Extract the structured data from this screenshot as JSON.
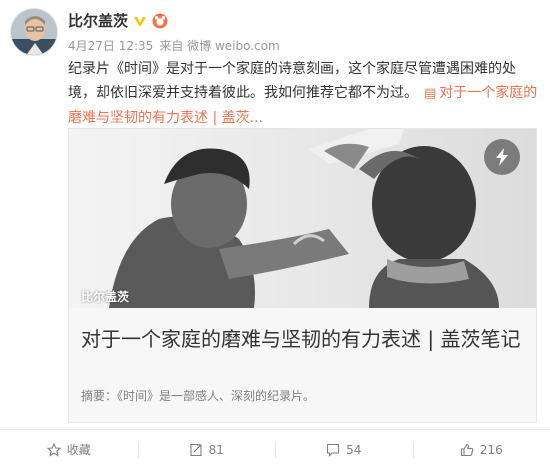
{
  "post": {
    "author": "比尔盖茨",
    "date": "4月27日 12:35",
    "source": "来自 微博 weibo.com",
    "text": "纪录片《时间》是对于一个家庭的诗意刻画，这个家庭尽管遭遇困难的处境，却依旧深爱并支持着彼此。我如何推荐它都不为过。",
    "link_text": "对于一个家庭的磨难与坚韧的有力表述 | 盖茨...",
    "link_icon": "link-icon"
  },
  "card": {
    "watermark": "比尔盖茨",
    "title": "对于一个家庭的磨难与坚韧的有力表述 | 盖茨笔记",
    "summary": "摘要：《时间》是一部感人、深刻的纪录片。"
  },
  "actions": {
    "favorite_label": "收藏",
    "repost_count": "81",
    "comment_count": "54",
    "like_count": "216"
  },
  "colors": {
    "link": "#eb7350",
    "verified": "#ffc200",
    "text": "#333333",
    "muted": "#808080"
  }
}
